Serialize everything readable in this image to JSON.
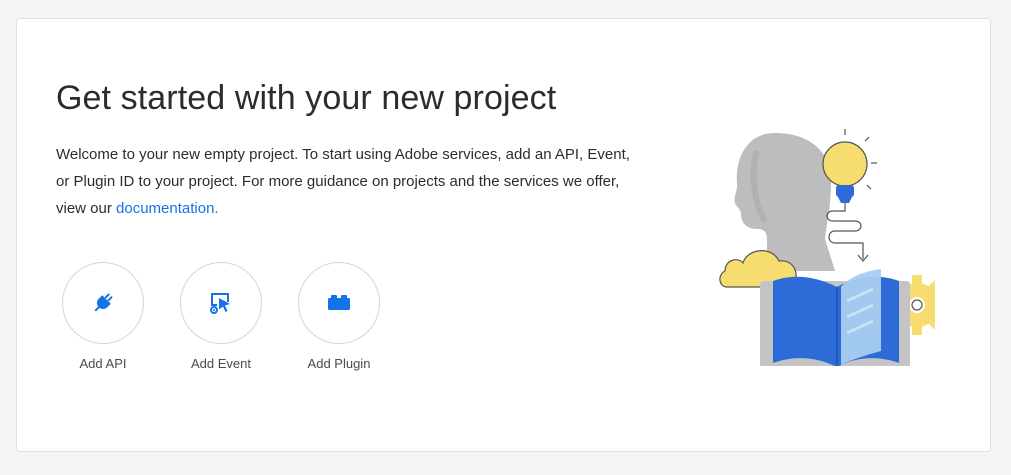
{
  "header": {
    "title": "Get started with your new project"
  },
  "intro": {
    "text_before_link": "Welcome to your new empty project. To start using Adobe services, add an API, Event, or Plugin ID to your project. For more guidance on projects and the services we offer, view our ",
    "link_text": "documentation.",
    "link_color": "#1473e6"
  },
  "actions": [
    {
      "label": "Add API",
      "icon": "plug-icon"
    },
    {
      "label": "Add Event",
      "icon": "event-cursor-icon"
    },
    {
      "label": "Add Plugin",
      "icon": "plugin-block-icon"
    }
  ],
  "colors": {
    "accent": "#1473e6",
    "bulb": "#f7dc6f",
    "book": "#2c6bd8"
  },
  "illustration": {
    "icon": "knowledge-illustration"
  }
}
